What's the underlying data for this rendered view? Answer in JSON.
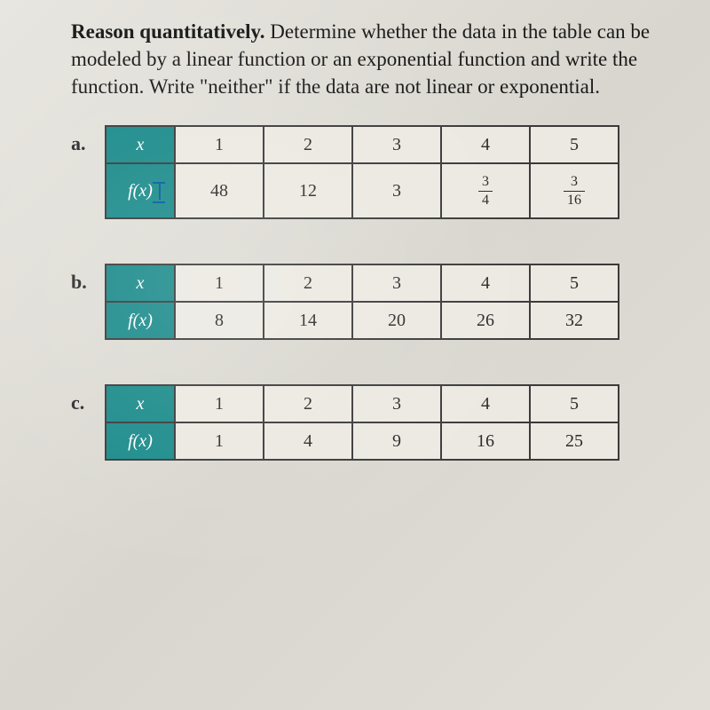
{
  "prompt": {
    "bold": "Reason quantitatively.",
    "rest": " Determine whether the data in the table can be modeled by a linear function or an exponential function and write the function. Write \"neither\" if the data are not linear or exponential."
  },
  "problems": [
    {
      "label": "a.",
      "row1_header": "x",
      "row2_header": "f(x)",
      "has_cursor": true,
      "tall_second_row": true,
      "row1": [
        "1",
        "2",
        "3",
        "4",
        "5"
      ],
      "row2": [
        "48",
        "12",
        "3",
        {
          "num": "3",
          "den": "4"
        },
        {
          "num": "3",
          "den": "16"
        }
      ]
    },
    {
      "label": "b.",
      "row1_header": "x",
      "row2_header": "f(x)",
      "has_cursor": false,
      "tall_second_row": false,
      "row1": [
        "1",
        "2",
        "3",
        "4",
        "5"
      ],
      "row2": [
        "8",
        "14",
        "20",
        "26",
        "32"
      ]
    },
    {
      "label": "c.",
      "row1_header": "x",
      "row2_header": "f(x)",
      "has_cursor": false,
      "tall_second_row": false,
      "row1": [
        "1",
        "2",
        "3",
        "4",
        "5"
      ],
      "row2": [
        "1",
        "4",
        "9",
        "16",
        "25"
      ]
    }
  ],
  "chart_data": [
    {
      "type": "table",
      "title": "Problem a",
      "columns": [
        "x",
        "f(x)"
      ],
      "rows": [
        [
          1,
          48
        ],
        [
          2,
          12
        ],
        [
          3,
          3
        ],
        [
          4,
          "3/4"
        ],
        [
          5,
          "3/16"
        ]
      ]
    },
    {
      "type": "table",
      "title": "Problem b",
      "columns": [
        "x",
        "f(x)"
      ],
      "rows": [
        [
          1,
          8
        ],
        [
          2,
          14
        ],
        [
          3,
          20
        ],
        [
          4,
          26
        ],
        [
          5,
          32
        ]
      ]
    },
    {
      "type": "table",
      "title": "Problem c",
      "columns": [
        "x",
        "f(x)"
      ],
      "rows": [
        [
          1,
          1
        ],
        [
          2,
          4
        ],
        [
          3,
          9
        ],
        [
          4,
          16
        ],
        [
          5,
          25
        ]
      ]
    }
  ]
}
